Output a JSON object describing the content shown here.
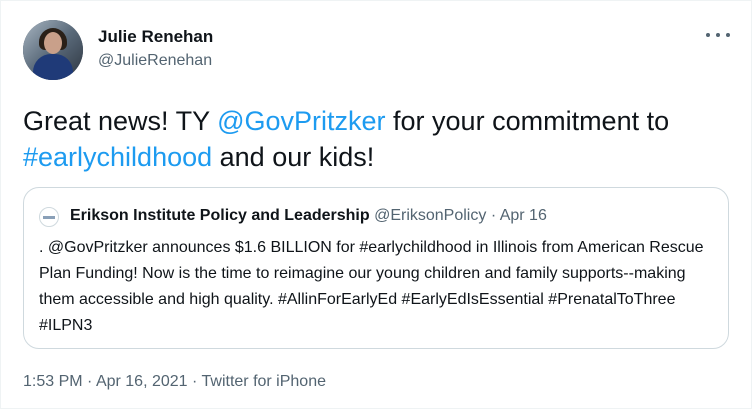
{
  "author": {
    "name": "Julie Renehan",
    "handle": "@JulieRenehan"
  },
  "tweet": {
    "text_before": "Great news! TY ",
    "mention": "@GovPritzker",
    "text_middle": " for your commitment to ",
    "hashtag": "#earlychildhood",
    "text_after": " and our kids!"
  },
  "quoted": {
    "name": "Erikson Institute Policy and Leadership",
    "handle": "@EriksonPolicy",
    "separator": "·",
    "date": "Apr 16",
    "text": ". @GovPritzker announces $1.6 BILLION for #earlychildhood in Illinois from American Rescue Plan Funding! Now is the time to reimagine our young children and family supports--making them accessible and high quality. #AllinForEarlyEd #EarlyEdIsEssential #PrenatalToThree #ILPN3"
  },
  "footer": {
    "time": "1:53 PM",
    "sep1": "·",
    "date": "Apr 16, 2021",
    "sep2": "·",
    "source": "Twitter for iPhone"
  },
  "icons": {
    "more": "more-horizontal-icon"
  },
  "colors": {
    "link": "#1d9bf0",
    "secondary_text": "#536471",
    "primary_text": "#0f1419",
    "border": "#cfd9de"
  }
}
